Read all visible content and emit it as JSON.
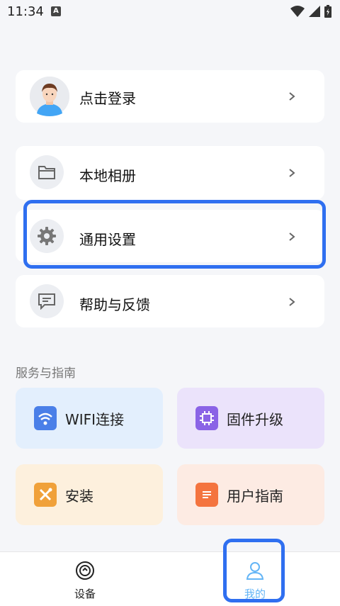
{
  "status_bar": {
    "time": "11:34",
    "notif_letter": "A"
  },
  "rows": {
    "login": "点击登录",
    "album": "本地相册",
    "settings": "通用设置",
    "help": "帮助与反馈"
  },
  "section": {
    "title": "服务与指南"
  },
  "tiles": {
    "wifi": "WIFI连接",
    "firmware": "固件升级",
    "install": "安装",
    "guide": "用户指南"
  },
  "nav": {
    "devices": "设备",
    "mine": "我的"
  },
  "colors": {
    "highlight": "#2f6ff0",
    "wifi_bg": "#e3effd",
    "firmware_bg": "#ebe3fb",
    "install_bg": "#fdf0dd",
    "guide_bg": "#fdebe3",
    "active_nav": "#64b5f6"
  }
}
